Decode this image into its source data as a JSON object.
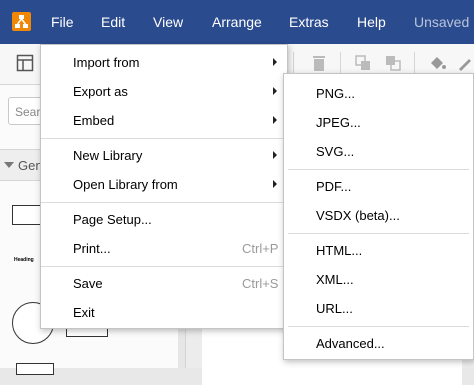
{
  "menubar": {
    "items": [
      "File",
      "Edit",
      "View",
      "Arrange",
      "Extras",
      "Help"
    ],
    "status": "Unsaved"
  },
  "sidebar": {
    "search_placeholder": "Sear",
    "section_label": "Gen",
    "heading_sample": "Heading"
  },
  "file_menu": {
    "items": [
      {
        "label": "Import from",
        "submenu": true
      },
      {
        "label": "Export as",
        "submenu": true
      },
      {
        "label": "Embed",
        "submenu": true
      },
      {
        "label": "New Library",
        "submenu": true
      },
      {
        "label": "Open Library from",
        "submenu": true
      },
      {
        "label": "Page Setup..."
      },
      {
        "label": "Print...",
        "shortcut": "Ctrl+P"
      },
      {
        "label": "Save",
        "shortcut": "Ctrl+S"
      },
      {
        "label": "Exit"
      }
    ]
  },
  "export_menu": {
    "items": [
      "PNG...",
      "JPEG...",
      "SVG...",
      "PDF...",
      "VSDX (beta)...",
      "HTML...",
      "XML...",
      "URL...",
      "Advanced..."
    ]
  },
  "colors": {
    "menubar_bg": "#2b4b8f",
    "logo": "#f08705"
  },
  "icons": [
    "app-logo-icon",
    "format-panel-icon",
    "delete-icon",
    "to-front-icon",
    "to-back-icon",
    "fill-color-icon",
    "line-color-icon"
  ]
}
